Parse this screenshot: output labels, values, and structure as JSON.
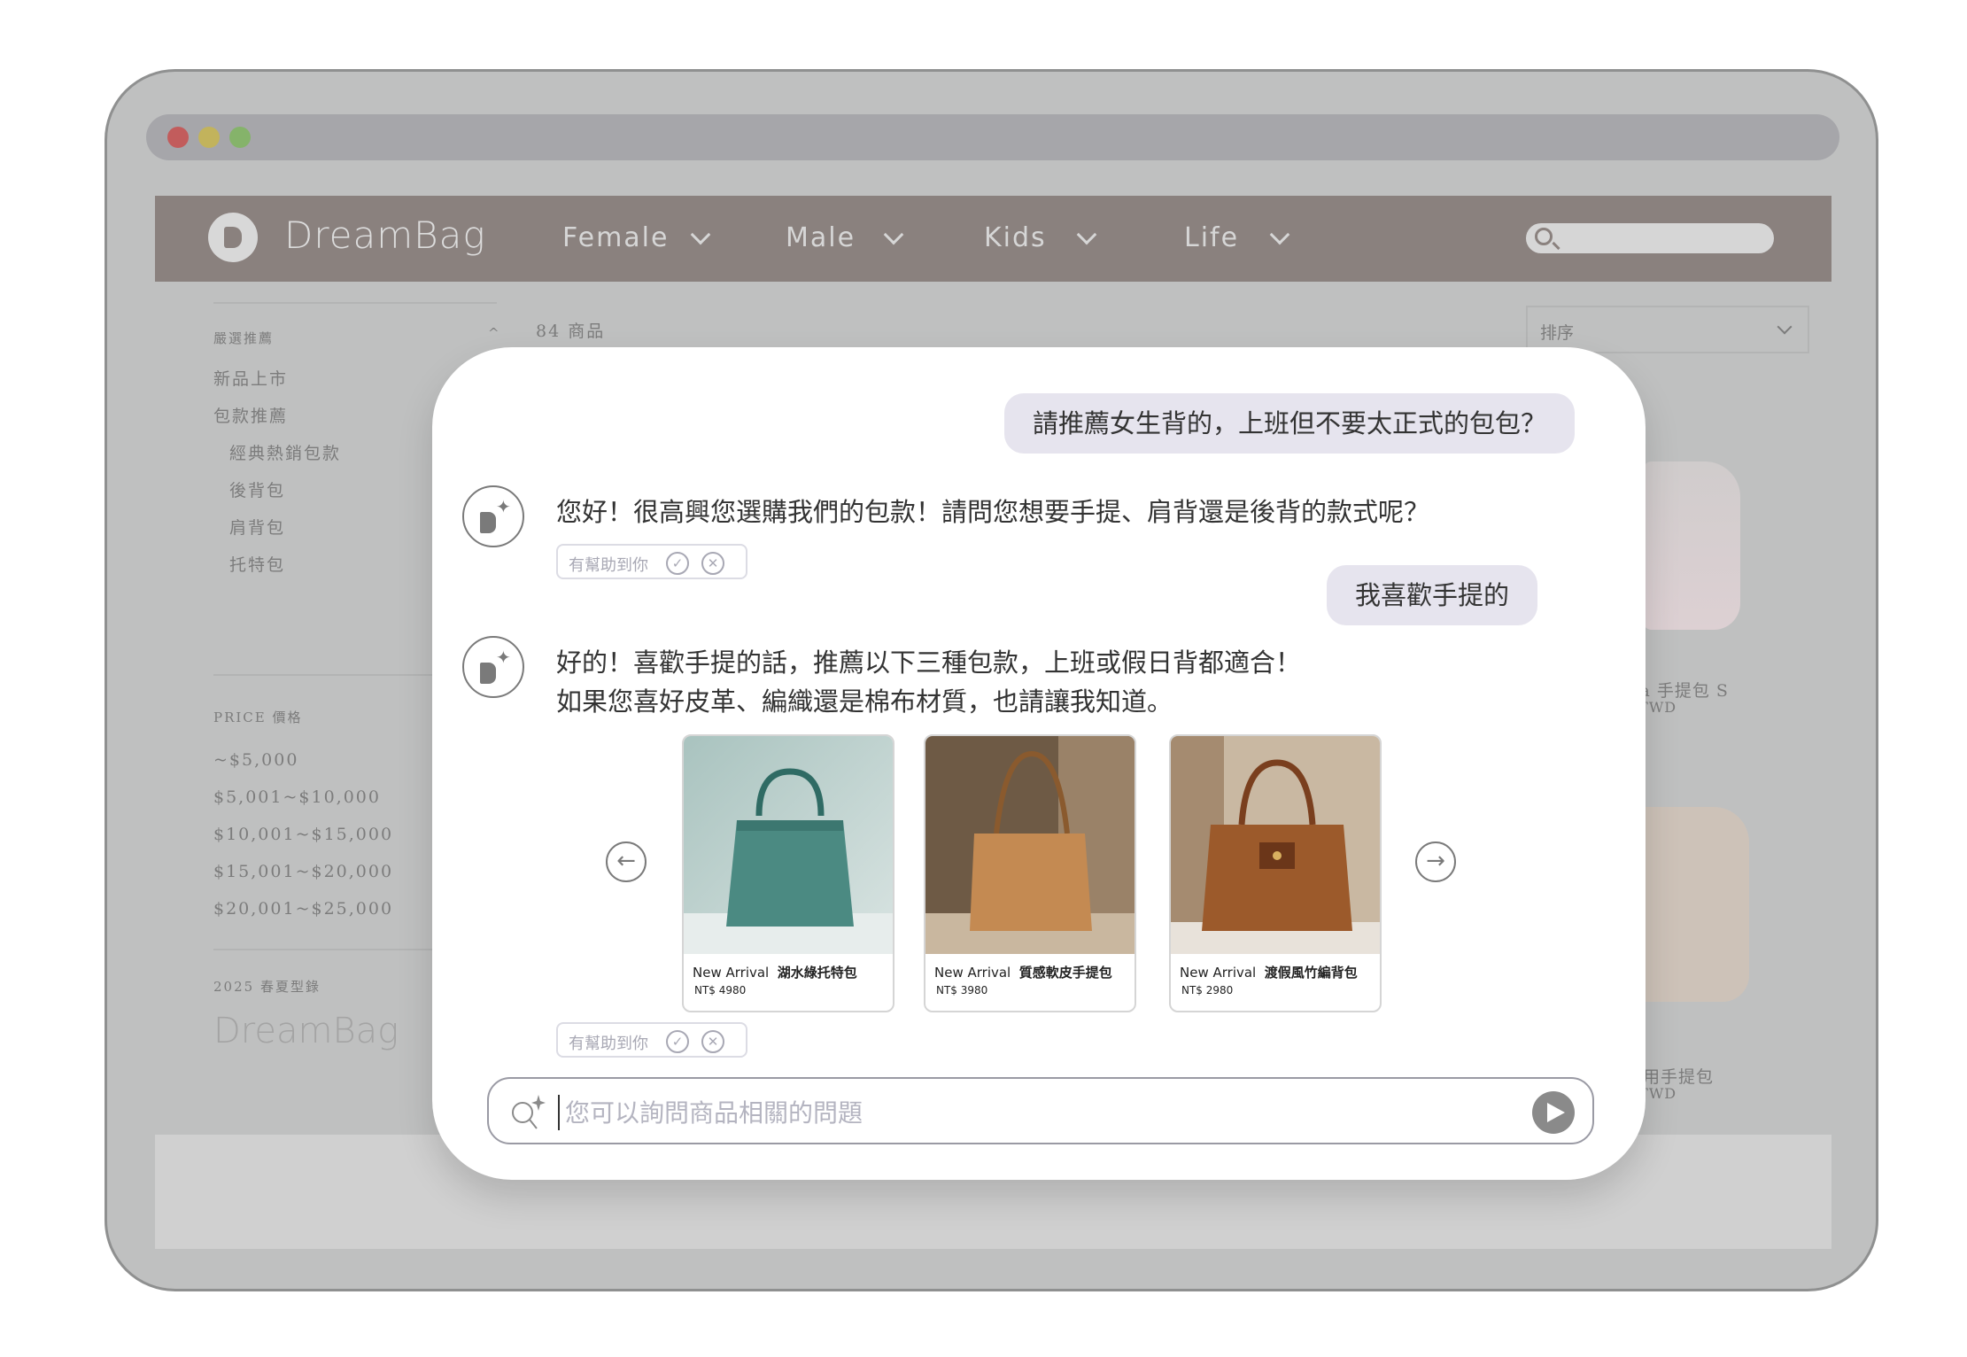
{
  "site": {
    "logo_text": "DreamBag",
    "nav": [
      {
        "label": "Female"
      },
      {
        "label": "Male"
      },
      {
        "label": "Kids"
      },
      {
        "label": "Life"
      }
    ],
    "search_placeholder": ""
  },
  "sidebar": {
    "section1_title": "嚴選推薦",
    "items": [
      "新品上市",
      "包款推薦"
    ],
    "sub_items": [
      "經典熱銷包款",
      "後背包",
      "肩背包",
      "托特包"
    ],
    "price_title": "PRICE 價格",
    "prices": [
      "~$5,000",
      "$5,001~$10,000",
      "$10,001~$15,000",
      "$15,001~$20,000",
      "$20,001~$25,000"
    ],
    "collection_title": "2025 春夏型錄",
    "collection_logo": "DreamBag"
  },
  "listing": {
    "count": "84 商品",
    "sort_label": "排序",
    "bg_product1_name": "ka 手提包 S",
    "bg_product1_price": "0TWD",
    "bg_product2_name": "用手提包",
    "bg_product2_price": "0TWD"
  },
  "chat": {
    "user_msg1": "請推薦女生背的，上班但不要太正式的包包？",
    "bot_msg1": "您好！很高興您選購我們的包款！請問您想要手提、肩背還是後背的款式呢？",
    "feedback_label": "有幫助到你",
    "user_msg2": "我喜歡手提的",
    "bot_msg2_line1": "好的！喜歡手提的話，推薦以下三種包款，上班或假日背都適合！",
    "bot_msg2_line2": "如果您喜好皮革、編織還是棉布材質，也請讓我知道。",
    "products": [
      {
        "tag": "New Arrival",
        "name": "湖水綠托特包",
        "price": "NT$ 4980"
      },
      {
        "tag": "New Arrival",
        "name": "質感軟皮手提包",
        "price": "NT$ 3980"
      },
      {
        "tag": "New Arrival",
        "name": "渡假風竹編背包",
        "price": "NT$ 2980"
      }
    ],
    "input_placeholder": "您可以詢問商品相關的問題"
  },
  "colors": {
    "nav_bg": "#8a817e",
    "bubble_user": "#e6e4ee",
    "frame": "#bfc0c0"
  }
}
